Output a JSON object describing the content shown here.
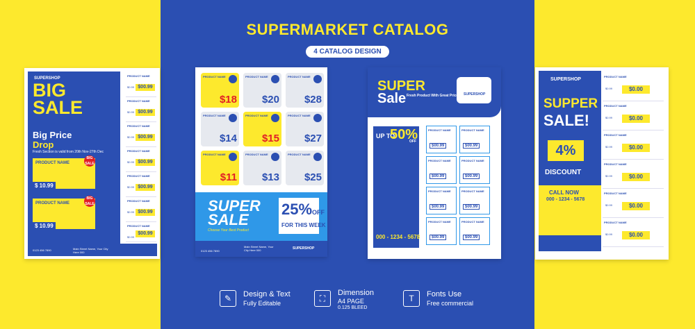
{
  "header": {
    "title": "SUPERMARKET CATALOG",
    "badge": "4 CATALOG DESIGN"
  },
  "flyer1": {
    "shop": "SUPERSHOP",
    "big": "BIG",
    "sale": "SALE",
    "headline1": "Big Price",
    "headline2": "Drop",
    "small": "Fresh Section is valid from 20th Nov-27th Dec",
    "product": "PRODUCT NAME",
    "price": "$ 10.99",
    "badge": "BIG SALE",
    "row_price": "$00.99",
    "row_old": "$0.99",
    "footer_phone": "0123 456 7890",
    "footer_addr": "Main Street Name, Your City Here 000"
  },
  "flyer2": {
    "product": "PRODUCT NAME",
    "prices": [
      "$18",
      "$20",
      "$28",
      "$14",
      "$15",
      "$27",
      "$11",
      "$13",
      "$25"
    ],
    "super": "SUPER",
    "sale": "SALE",
    "choose": "Choose Your Best Product",
    "off_value": "25%",
    "off_label": "OFF",
    "week": "FOR THIS WEEK",
    "footer_phone": "0123 456 7890",
    "footer_addr": "Main Street Name, Your City Here 000",
    "shop": "SUPERSHOP"
  },
  "flyer3": {
    "super": "SUPER",
    "sale": "Sale",
    "sub": "Fresh Product With Great Price",
    "shop": "SUPERSHOP",
    "upto": "UP TO",
    "fifty": "50%",
    "off": "OFF",
    "product": "PRODUCT NAME",
    "price": "$00.99",
    "phone": "000 - 1234 - 5678"
  },
  "flyer4": {
    "shop": "SUPERSHOP",
    "supper": "SUPPER",
    "sale": "SALE!",
    "pct": "4%",
    "discount": "DISCOUNT",
    "call": "CALL NOW",
    "num": "000 - 1234 - 5678",
    "product": "PRODUCT NAME",
    "price": "$0.00",
    "old": "$0.99"
  },
  "features": [
    {
      "icon": "✎",
      "main": "Design & Text",
      "sub": "Fully Editable"
    },
    {
      "icon": "⛶",
      "main": "Dimension",
      "sub": "A4 PAGE",
      "sub2": "0.125 BLEED"
    },
    {
      "icon": "T",
      "main": "Fonts Use",
      "sub": "Free commercial"
    }
  ]
}
